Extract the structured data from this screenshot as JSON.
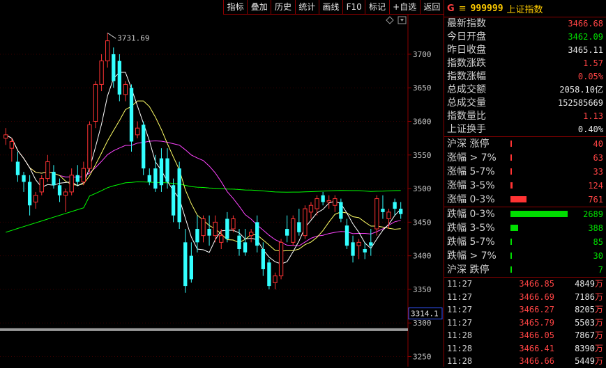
{
  "toolbar": [
    "指标",
    "叠加",
    "历史",
    "统计",
    "画线",
    "F10",
    "标记",
    "+自选",
    "返回"
  ],
  "chart": {
    "colors": {
      "up": "#ff3333",
      "down": "#33ffff",
      "ma5": "#ffffff",
      "ma10": "#ffff66",
      "ma20": "#ff44ff",
      "ma60": "#00ff00",
      "axis": "#8b0000",
      "tick": "#c8c8c8"
    },
    "ylim": [
      3235,
      3760
    ],
    "yticks": [
      "3700",
      "3650",
      "3600",
      "3550",
      "3500",
      "3450",
      "3400",
      "3350",
      "3300",
      "3250"
    ],
    "high_label": "3731.69",
    "low_box": "3314.1",
    "candles": [
      [
        3575,
        3590,
        3565,
        3580
      ],
      [
        3560,
        3575,
        3540,
        3570
      ],
      [
        3540,
        3555,
        3510,
        3520
      ],
      [
        3520,
        3525,
        3495,
        3510
      ],
      [
        3510,
        3520,
        3460,
        3475
      ],
      [
        3480,
        3495,
        3470,
        3490
      ],
      [
        3495,
        3520,
        3490,
        3515
      ],
      [
        3515,
        3550,
        3510,
        3540
      ],
      [
        3525,
        3535,
        3500,
        3505
      ],
      [
        3505,
        3515,
        3480,
        3490
      ],
      [
        3490,
        3500,
        3465,
        3495
      ],
      [
        3495,
        3530,
        3490,
        3520
      ],
      [
        3520,
        3535,
        3505,
        3510
      ],
      [
        3510,
        3540,
        3505,
        3530
      ],
      [
        3530,
        3600,
        3525,
        3595
      ],
      [
        3600,
        3660,
        3590,
        3655
      ],
      [
        3655,
        3700,
        3645,
        3690
      ],
      [
        3690,
        3731.69,
        3680,
        3720
      ],
      [
        3700,
        3710,
        3650,
        3660
      ],
      [
        3690,
        3700,
        3630,
        3640
      ],
      [
        3640,
        3660,
        3630,
        3655
      ],
      [
        3650,
        3655,
        3555,
        3570
      ],
      [
        3580,
        3600,
        3575,
        3590
      ],
      [
        3595,
        3600,
        3520,
        3530
      ],
      [
        3520,
        3530,
        3505,
        3510
      ],
      [
        3530,
        3550,
        3495,
        3500
      ],
      [
        3545,
        3560,
        3495,
        3505
      ],
      [
        3545,
        3560,
        3500,
        3510
      ],
      [
        3505,
        3515,
        3450,
        3460
      ],
      [
        3530,
        3540,
        3440,
        3450
      ],
      [
        3420,
        3440,
        3345,
        3355
      ],
      [
        3400,
        3420,
        3360,
        3365
      ],
      [
        3440,
        3460,
        3405,
        3420
      ],
      [
        3430,
        3460,
        3420,
        3455
      ],
      [
        3440,
        3460,
        3415,
        3430
      ],
      [
        3430,
        3460,
        3420,
        3450
      ],
      [
        3420,
        3440,
        3410,
        3430
      ],
      [
        3455,
        3465,
        3420,
        3425
      ],
      [
        3440,
        3460,
        3435,
        3455
      ],
      [
        3430,
        3440,
        3400,
        3410
      ],
      [
        3420,
        3440,
        3400,
        3405
      ],
      [
        3430,
        3440,
        3420,
        3435
      ],
      [
        3450,
        3460,
        3405,
        3415
      ],
      [
        3410,
        3420,
        3370,
        3380
      ],
      [
        3390,
        3395,
        3350,
        3355
      ],
      [
        3360,
        3375,
        3350,
        3370
      ],
      [
        3370,
        3425,
        3365,
        3420
      ],
      [
        3440,
        3460,
        3420,
        3430
      ],
      [
        3420,
        3460,
        3415,
        3455
      ],
      [
        3450,
        3470,
        3430,
        3435
      ],
      [
        3430,
        3475,
        3425,
        3470
      ],
      [
        3465,
        3480,
        3455,
        3475
      ],
      [
        3470,
        3490,
        3460,
        3485
      ],
      [
        3490,
        3495,
        3475,
        3480
      ],
      [
        3480,
        3490,
        3470,
        3482
      ],
      [
        3475,
        3490,
        3465,
        3485
      ],
      [
        3480,
        3485,
        3450,
        3455
      ],
      [
        3445,
        3455,
        3410,
        3415
      ],
      [
        3420,
        3430,
        3390,
        3400
      ],
      [
        3415,
        3425,
        3395,
        3420
      ],
      [
        3410,
        3420,
        3395,
        3405
      ],
      [
        3420,
        3440,
        3400,
        3415
      ],
      [
        3440,
        3490,
        3430,
        3485
      ],
      [
        3470,
        3490,
        3455,
        3465
      ],
      [
        3455,
        3470,
        3440,
        3465
      ],
      [
        3480,
        3485,
        3460,
        3470
      ],
      [
        3470,
        3480,
        3455,
        3462.09
      ]
    ]
  },
  "header": {
    "g": "G",
    "eq": "≡",
    "code": "999999",
    "name": "上证指数"
  },
  "stats": [
    {
      "label": "最新指数",
      "value": "3466.68",
      "color": "red"
    },
    {
      "label": "今日开盘",
      "value": "3462.09",
      "color": "green"
    },
    {
      "label": "昨日收盘",
      "value": "3465.11",
      "color": "white"
    },
    {
      "label": "指数涨跌",
      "value": "1.57",
      "color": "red"
    },
    {
      "label": "指数涨幅",
      "value": "0.05%",
      "color": "red"
    },
    {
      "label": "总成交额",
      "value": "2058.10亿",
      "color": "white"
    },
    {
      "label": "总成交量",
      "value": "152585669",
      "color": "white"
    },
    {
      "label": "指数量比",
      "value": "1.13",
      "color": "red"
    },
    {
      "label": "上证换手",
      "value": "0.40%",
      "color": "white"
    }
  ],
  "breadth": [
    {
      "label": "沪深 涨停",
      "value": "40",
      "color": "red",
      "ratio": 0.006
    },
    {
      "label": "涨幅 > 7%",
      "value": "63",
      "color": "red",
      "ratio": 0.01
    },
    {
      "label": "涨幅 5-7%",
      "value": "33",
      "color": "red",
      "ratio": 0.006
    },
    {
      "label": "涨幅 3-5%",
      "value": "124",
      "color": "red",
      "ratio": 0.04
    },
    {
      "label": "涨幅 0-3%",
      "value": "761",
      "color": "red",
      "ratio": 0.28
    },
    {
      "label": "跌幅 0-3%",
      "value": "2689",
      "color": "green",
      "ratio": 1.0
    },
    {
      "label": "跌幅 3-5%",
      "value": "388",
      "color": "green",
      "ratio": 0.14
    },
    {
      "label": "跌幅 5-7%",
      "value": "85",
      "color": "green",
      "ratio": 0.03
    },
    {
      "label": "跌幅 > 7%",
      "value": "30",
      "color": "green",
      "ratio": 0.01
    },
    {
      "label": "沪深 跌停",
      "value": "7",
      "color": "green",
      "ratio": 0.005
    }
  ],
  "trades": [
    {
      "time": "11:27",
      "price": "3466.85",
      "vol": "4849",
      "unit": "万"
    },
    {
      "time": "11:27",
      "price": "3466.69",
      "vol": "7186",
      "unit": "万"
    },
    {
      "time": "11:27",
      "price": "3466.27",
      "vol": "8205",
      "unit": "万"
    },
    {
      "time": "11:27",
      "price": "3465.79",
      "vol": "5503",
      "unit": "万"
    },
    {
      "time": "11:28",
      "price": "3466.05",
      "vol": "7867",
      "unit": "万"
    },
    {
      "time": "11:28",
      "price": "3466.41",
      "vol": "8390",
      "unit": "万"
    },
    {
      "time": "11:28",
      "price": "3466.66",
      "vol": "5449",
      "unit": "万"
    }
  ]
}
